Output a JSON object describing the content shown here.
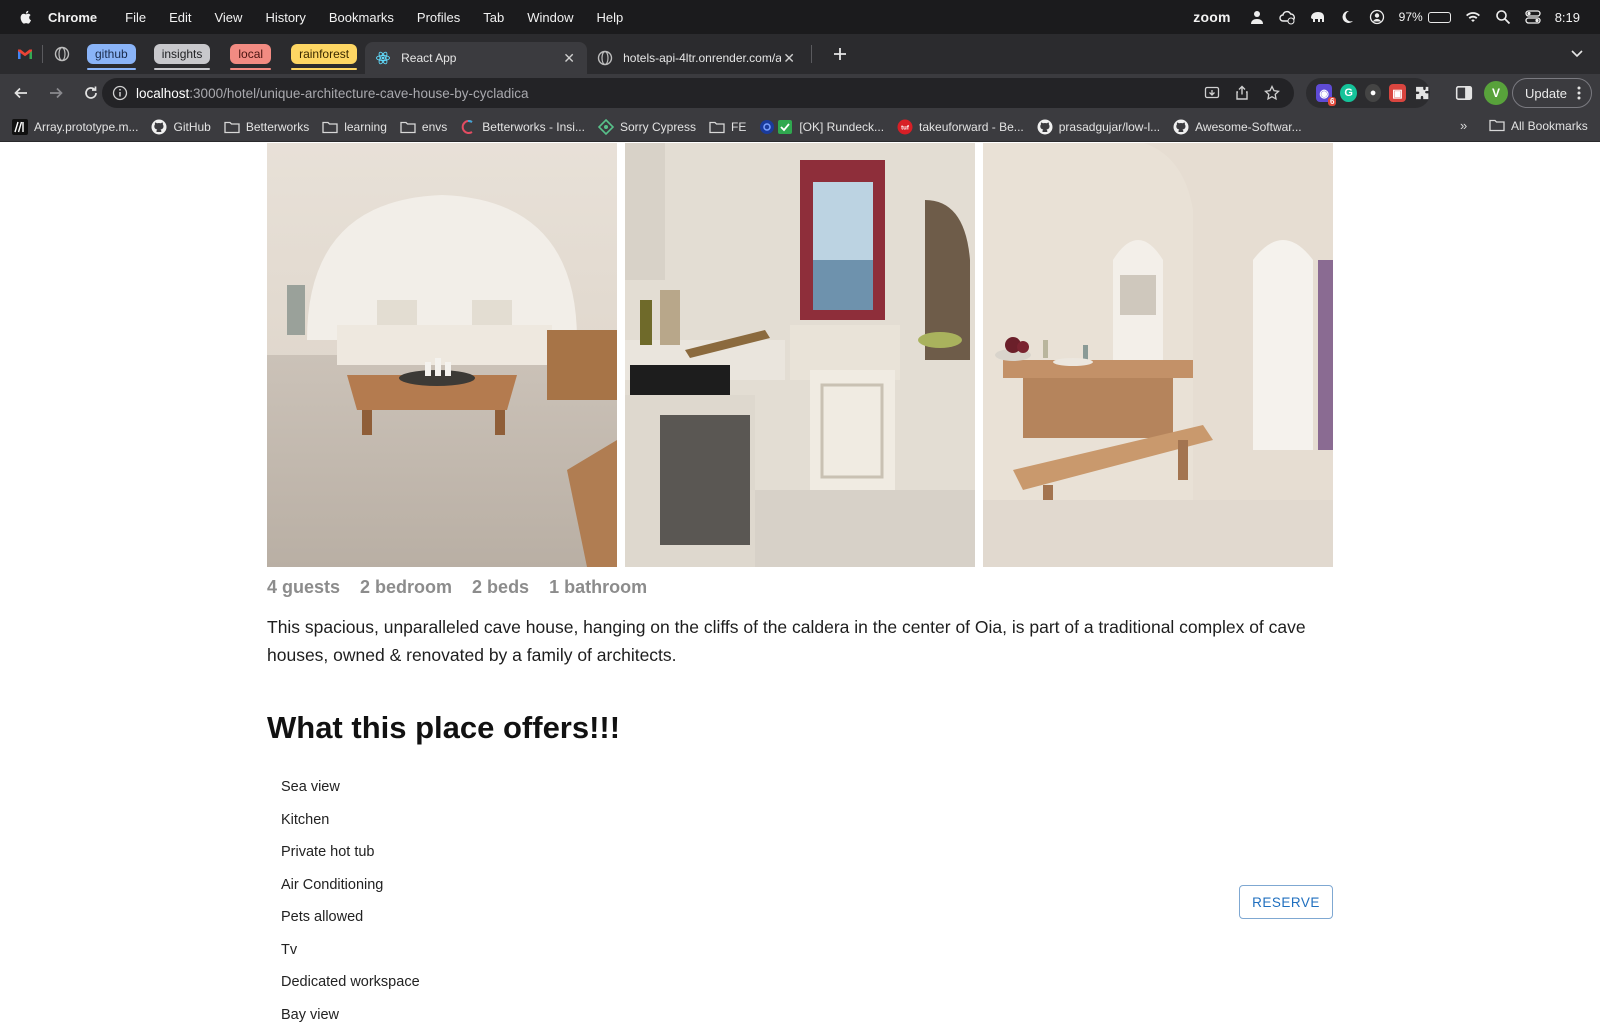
{
  "menubar": {
    "app_name": "Chrome",
    "items": [
      "File",
      "Edit",
      "View",
      "History",
      "Bookmarks",
      "Profiles",
      "Tab",
      "Window",
      "Help"
    ],
    "status": {
      "zoom_label": "zoom",
      "battery_percent": "97%",
      "battery_level": 0.97,
      "time": "8:19"
    }
  },
  "tabs": {
    "groups": [
      {
        "label": "github",
        "color": "#8ab4f8",
        "text_color": "#1a2b4c"
      },
      {
        "label": "insights",
        "color": "#c8c8cc",
        "text_color": "#202124"
      },
      {
        "label": "local",
        "color": "#f28b82",
        "text_color": "#4a1410"
      },
      {
        "label": "rainforest",
        "color": "#fdd663",
        "text_color": "#3b2a00"
      }
    ],
    "active": {
      "title": "React App"
    },
    "inactive": {
      "title": "hotels-api-4ltr.onrender.com/a"
    }
  },
  "toolbar": {
    "url_host": "localhost",
    "url_path": ":3000/hotel/unique-architecture-cave-house-by-cycladica",
    "extension_badge": "6",
    "profile_initial": "V",
    "update_label": "Update"
  },
  "bookmarks": {
    "items": [
      {
        "label": "Array.prototype.m...",
        "icon": "mdn-icon"
      },
      {
        "label": "GitHub",
        "icon": "github-icon"
      },
      {
        "label": "Betterworks",
        "icon": "folder-icon"
      },
      {
        "label": "learning",
        "icon": "folder-icon"
      },
      {
        "label": "envs",
        "icon": "folder-icon"
      },
      {
        "label": "Betterworks - Insi...",
        "icon": "betterworks-icon"
      },
      {
        "label": "Sorry Cypress",
        "icon": "cypress-icon"
      },
      {
        "label": "FE",
        "icon": "folder-icon"
      },
      {
        "label": "[OK] Rundeck...",
        "icon": "rundeck-icon"
      },
      {
        "label": "takeuforward - Be...",
        "icon": "takeuforward-icon"
      },
      {
        "label": "prasadgujar/low-l...",
        "icon": "github-icon"
      },
      {
        "label": "Awesome-Softwar...",
        "icon": "github-icon"
      }
    ],
    "overflow": "»",
    "all_bookmarks": "All Bookmarks"
  },
  "listing": {
    "stats": [
      "4 guests",
      "2 bedroom",
      "2 beds",
      "1 bathroom"
    ],
    "description": "This spacious, unparalleled cave house, hanging on the cliffs of the caldera in the center of Oia, is part of a traditional complex of cave houses, owned & renovated by a family of architects.",
    "offers_title": "What this place offers!!!",
    "amenities": [
      "Sea view",
      "Kitchen",
      "Private hot tub",
      "Air Conditioning",
      "Pets allowed",
      "Tv",
      "Dedicated workspace",
      "Bay view"
    ],
    "reserve_label": "RESERVE"
  }
}
